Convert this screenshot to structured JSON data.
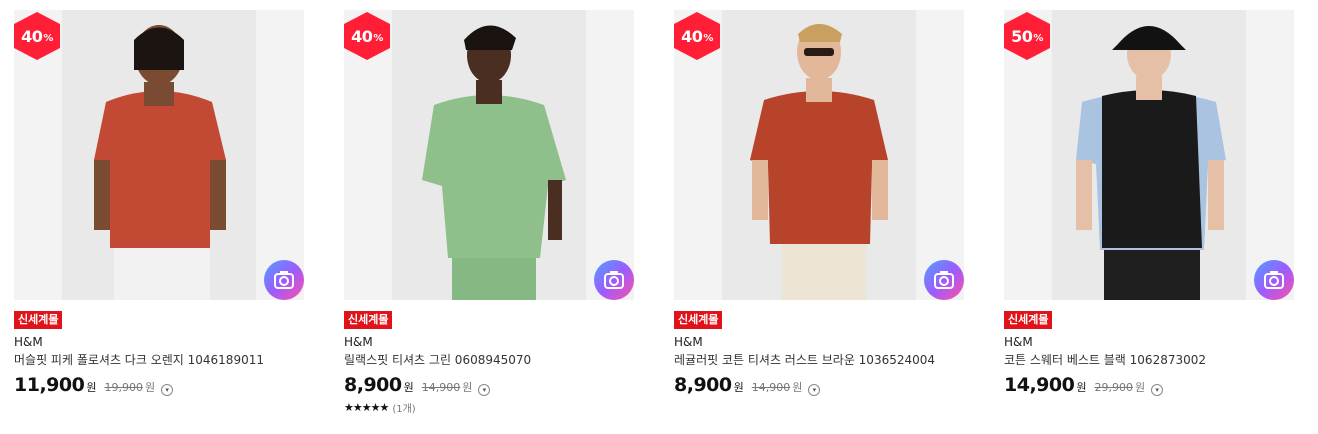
{
  "products": [
    {
      "discount": "40",
      "discount_unit": "%",
      "tag": "신세계몰",
      "brand": "H&M",
      "name": "머슬핏 피케 폴로셔츠 다크 오렌지 1046189011",
      "price": "11,900",
      "price_unit": "원",
      "original_price": "19,900",
      "original_unit": "원",
      "colors": {
        "shirt": "#c24a34",
        "pants": "#f2f2f2",
        "skin": "#7a4a33"
      }
    },
    {
      "discount": "40",
      "discount_unit": "%",
      "tag": "신세계몰",
      "brand": "H&M",
      "name": "릴랙스핏 티셔츠 그린 0608945070",
      "price": "8,900",
      "price_unit": "원",
      "original_price": "14,900",
      "original_unit": "원",
      "rating": {
        "stars": "★★★★★",
        "count": "(1개)"
      },
      "colors": {
        "shirt": "#8fbf8a",
        "pants": "#86b884",
        "skin": "#4a2e22"
      }
    },
    {
      "discount": "40",
      "discount_unit": "%",
      "tag": "신세계몰",
      "brand": "H&M",
      "name": "레귤러핏 코튼 티셔츠 러스트 브라운 1036524004",
      "price": "8,900",
      "price_unit": "원",
      "original_price": "14,900",
      "original_unit": "원",
      "colors": {
        "shirt": "#b8432b",
        "pants": "#ece4d4",
        "skin": "#e3b89a"
      }
    },
    {
      "discount": "50",
      "discount_unit": "%",
      "tag": "신세계몰",
      "brand": "H&M",
      "name": "코튼 스웨터 베스트 블랙 1062873002",
      "price": "14,900",
      "price_unit": "원",
      "original_price": "29,900",
      "original_unit": "원",
      "colors": {
        "shirt": "#1a1a1a",
        "sleeves": "#a9c3e0",
        "pants": "#1e1e1e",
        "skin": "#e6c0a6"
      }
    }
  ],
  "icons": {
    "camera": "camera-search-icon",
    "info": "info-circle-icon"
  }
}
